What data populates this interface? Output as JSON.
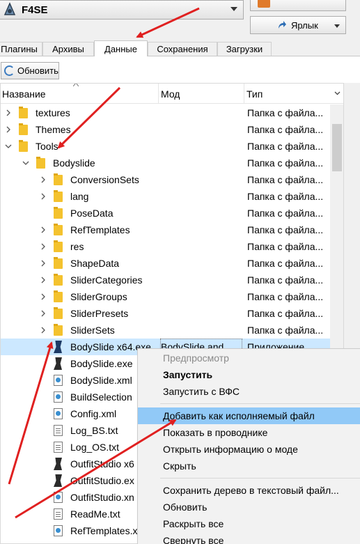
{
  "toolbar": {
    "executable": {
      "label": "F4SE",
      "icon": "f4se-icon"
    },
    "run_button": {
      "label": "",
      "icon": "run-icon"
    },
    "shortcut_button": {
      "label": "Ярлык",
      "icon": "shortcut-icon"
    }
  },
  "tabs": [
    {
      "label": "Плагины",
      "active": false
    },
    {
      "label": "Архивы",
      "active": false
    },
    {
      "label": "Данные",
      "active": true
    },
    {
      "label": "Сохранения",
      "active": false
    },
    {
      "label": "Загрузки",
      "active": false
    }
  ],
  "data_tab": {
    "refresh_label": "Обновить",
    "columns": {
      "name": "Название",
      "mod": "Мод",
      "type": "Тип"
    },
    "rows": [
      {
        "name": "textures",
        "mod": "",
        "type": "Папка с файла...",
        "kind": "folder",
        "expander": "collapsed"
      },
      {
        "name": "Themes",
        "mod": "",
        "type": "Папка с файла...",
        "kind": "folder",
        "expander": "collapsed"
      },
      {
        "name": "Tools",
        "mod": "",
        "type": "Папка с файла...",
        "kind": "folder",
        "expander": "expanded"
      },
      {
        "name": "Bodyslide",
        "mod": "",
        "type": "Папка с файла...",
        "kind": "folder",
        "expander": "expanded"
      },
      {
        "name": "ConversionSets",
        "mod": "",
        "type": "Папка с файла...",
        "kind": "folder",
        "expander": "collapsed"
      },
      {
        "name": "lang",
        "mod": "",
        "type": "Папка с файла...",
        "kind": "folder",
        "expander": "collapsed"
      },
      {
        "name": "PoseData",
        "mod": "",
        "type": "Папка с файла...",
        "kind": "folder",
        "expander": "none"
      },
      {
        "name": "RefTemplates",
        "mod": "",
        "type": "Папка с файла...",
        "kind": "folder",
        "expander": "collapsed"
      },
      {
        "name": "res",
        "mod": "",
        "type": "Папка с файла...",
        "kind": "folder",
        "expander": "collapsed"
      },
      {
        "name": "ShapeData",
        "mod": "",
        "type": "Папка с файла...",
        "kind": "folder",
        "expander": "collapsed"
      },
      {
        "name": "SliderCategories",
        "mod": "",
        "type": "Папка с файла...",
        "kind": "folder",
        "expander": "collapsed"
      },
      {
        "name": "SliderGroups",
        "mod": "",
        "type": "Папка с файла...",
        "kind": "folder",
        "expander": "collapsed"
      },
      {
        "name": "SliderPresets",
        "mod": "",
        "type": "Папка с файла...",
        "kind": "folder",
        "expander": "collapsed"
      },
      {
        "name": "SliderSets",
        "mod": "",
        "type": "Папка с файла...",
        "kind": "folder",
        "expander": "collapsed"
      },
      {
        "name": "BodySlide x64.exe",
        "mod": "BodySlide and...",
        "type": "Приложение",
        "kind": "exe-blue",
        "expander": "none",
        "selected": true
      },
      {
        "name": "BodySlide.exe",
        "mod": "",
        "type": "",
        "kind": "exe",
        "expander": "none"
      },
      {
        "name": "BodySlide.xml",
        "mod": "",
        "type": "",
        "kind": "xml",
        "expander": "none"
      },
      {
        "name": "BuildSelection",
        "mod": "",
        "type": "",
        "kind": "xml",
        "expander": "none"
      },
      {
        "name": "Config.xml",
        "mod": "",
        "type": "",
        "kind": "xml",
        "expander": "none"
      },
      {
        "name": "Log_BS.txt",
        "mod": "",
        "type": "",
        "kind": "txt",
        "expander": "none"
      },
      {
        "name": "Log_OS.txt",
        "mod": "",
        "type": "",
        "kind": "txt",
        "expander": "none"
      },
      {
        "name": "OutfitStudio x6",
        "mod": "",
        "type": "",
        "kind": "exe",
        "expander": "none"
      },
      {
        "name": "OutfitStudio.ex",
        "mod": "",
        "type": "",
        "kind": "exe",
        "expander": "none"
      },
      {
        "name": "OutfitStudio.xn",
        "mod": "",
        "type": "",
        "kind": "xml",
        "expander": "none"
      },
      {
        "name": "ReadMe.txt",
        "mod": "",
        "type": "",
        "kind": "txt",
        "expander": "none"
      },
      {
        "name": "RefTemplates.x",
        "mod": "",
        "type": "",
        "kind": "xml",
        "expander": "none"
      }
    ]
  },
  "context_menu": {
    "items": [
      {
        "label": "Предпросмотр",
        "state": "disabled"
      },
      {
        "label": "Запустить",
        "state": "bold"
      },
      {
        "label": "Запустить с ВФС",
        "state": "normal"
      },
      {
        "separator": true
      },
      {
        "label": "Добавить как исполняемый файл",
        "state": "highlighted"
      },
      {
        "label": "Показать в проводнике",
        "state": "normal"
      },
      {
        "label": "Открыть информацию о моде",
        "state": "normal"
      },
      {
        "label": "Скрыть",
        "state": "normal"
      },
      {
        "separator": true
      },
      {
        "label": "Сохранить дерево в текстовый файл...",
        "state": "normal"
      },
      {
        "label": "Обновить",
        "state": "normal"
      },
      {
        "label": "Раскрыть все",
        "state": "normal"
      },
      {
        "label": "Свернуть все",
        "state": "normal"
      }
    ]
  },
  "colors": {
    "selection": "#cce8ff",
    "menu_highlight": "#91c9f7",
    "annotation_arrow": "#e02020",
    "folder": "#f4c22e"
  }
}
